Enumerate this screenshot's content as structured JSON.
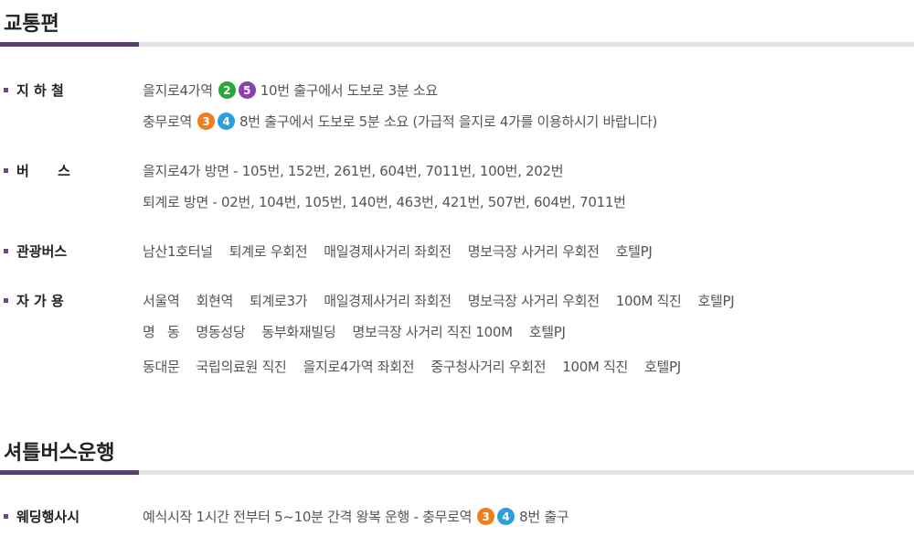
{
  "section1": {
    "title": "교통편"
  },
  "subway": {
    "label": "지 하 철",
    "line1": {
      "pre": "을지로4가역",
      "badges": [
        {
          "num": "2",
          "color": "#27a83a"
        },
        {
          "num": "5",
          "color": "#8b3fb1"
        }
      ],
      "post": "10번 출구에서 도보로 3분 소요"
    },
    "line2": {
      "pre": "충무로역",
      "badges": [
        {
          "num": "3",
          "color": "#f07d1b"
        },
        {
          "num": "4",
          "color": "#2d9fe0"
        }
      ],
      "post": "8번 출구에서 도보로 5분 소요 (가급적 을지로 4가를 이용하시기 바랍니다)"
    }
  },
  "bus": {
    "label": "버      스",
    "line1": "을지로4가 방면 - 105번, 152번, 261번, 604번, 7011번, 100번, 202번",
    "line2": "퇴계로 방면 - 02번, 104번, 105번, 140번, 463번, 421번, 507번, 604번, 7011번"
  },
  "tourbus": {
    "label": "관광버스",
    "items": [
      "남산1호터널",
      "퇴계로 우회전",
      "매일경제사거리 좌회전",
      "명보극장 사거리 우회전",
      "호텔PJ"
    ]
  },
  "car": {
    "label": "자 가 용",
    "rows": [
      [
        "서울역",
        "회현역",
        "퇴계로3가",
        "매일경제사거리 좌회전",
        "명보극장 사거리 우회전",
        "100M 직진",
        "호텔PJ"
      ],
      [
        "명   동",
        "명동성당",
        "동부화재빌딩",
        "명보극장 사거리 직진 100M",
        "호텔PJ"
      ],
      [
        "동대문",
        "국립의료원 직진",
        "을지로4가역 좌회전",
        "중구청사거리 우회전",
        "100M 직진",
        "호텔PJ"
      ]
    ]
  },
  "section2": {
    "title": "셔틀버스운행"
  },
  "shuttle": {
    "label": "웨딩행사시",
    "pre": "예식시작 1시간 전부터 5~10분 간격 왕복 운행 - 충무로역",
    "badges": [
      {
        "num": "3",
        "color": "#f07d1b"
      },
      {
        "num": "4",
        "color": "#2d9fe0"
      }
    ],
    "post": "8번 출구"
  }
}
